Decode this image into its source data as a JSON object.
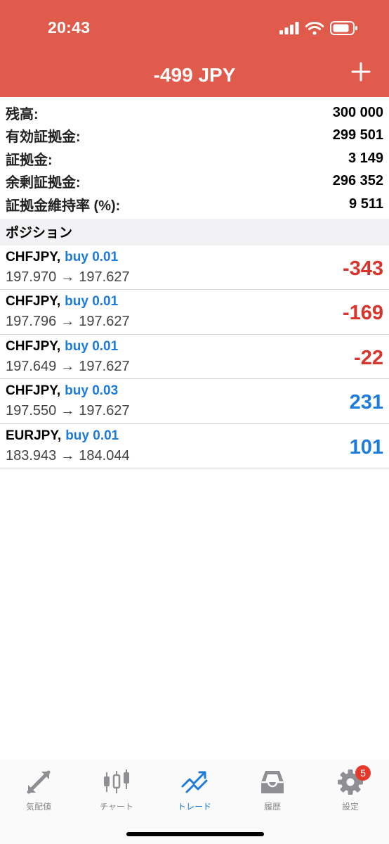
{
  "status_bar": {
    "time": "20:43"
  },
  "header": {
    "title": "-499 JPY"
  },
  "summary": [
    {
      "label": "残高:",
      "value": "300 000"
    },
    {
      "label": "有効証拠金:",
      "value": "299 501"
    },
    {
      "label": "証拠金:",
      "value": "3 149"
    },
    {
      "label": "余剰証拠金:",
      "value": "296 352"
    },
    {
      "label": "証拠金維持率 (%):",
      "value": "9 511"
    }
  ],
  "positions_section": {
    "title": "ポジション"
  },
  "positions": [
    {
      "symbol": "CHFJPY,",
      "side": "buy 0.01",
      "open": "197.970",
      "arrow": "→",
      "current": "197.627",
      "profit": "-343"
    },
    {
      "symbol": "CHFJPY,",
      "side": "buy 0.01",
      "open": "197.796",
      "arrow": "→",
      "current": "197.627",
      "profit": "-169"
    },
    {
      "symbol": "CHFJPY,",
      "side": "buy 0.01",
      "open": "197.649",
      "arrow": "→",
      "current": "197.627",
      "profit": "-22"
    },
    {
      "symbol": "CHFJPY,",
      "side": "buy 0.03",
      "open": "197.550",
      "arrow": "→",
      "current": "197.627",
      "profit": "231"
    },
    {
      "symbol": "EURJPY,",
      "side": "buy 0.01",
      "open": "183.943",
      "arrow": "→",
      "current": "184.044",
      "profit": "101"
    }
  ],
  "tabbar": {
    "tabs": [
      {
        "label": "気配値",
        "icon": "quotes-icon"
      },
      {
        "label": "チャート",
        "icon": "candlestick-chart-icon"
      },
      {
        "label": "トレード",
        "icon": "trade-icon",
        "active": true
      },
      {
        "label": "履歴",
        "icon": "history-tray-icon"
      },
      {
        "label": "設定",
        "icon": "gear-icon",
        "badge": "5"
      }
    ]
  },
  "colors": {
    "header_bg": "#e05b4b",
    "negative": "#d9342b",
    "positive": "#1d7bdb",
    "accent": "#1d7bdb",
    "badge": "#e53a2b"
  }
}
